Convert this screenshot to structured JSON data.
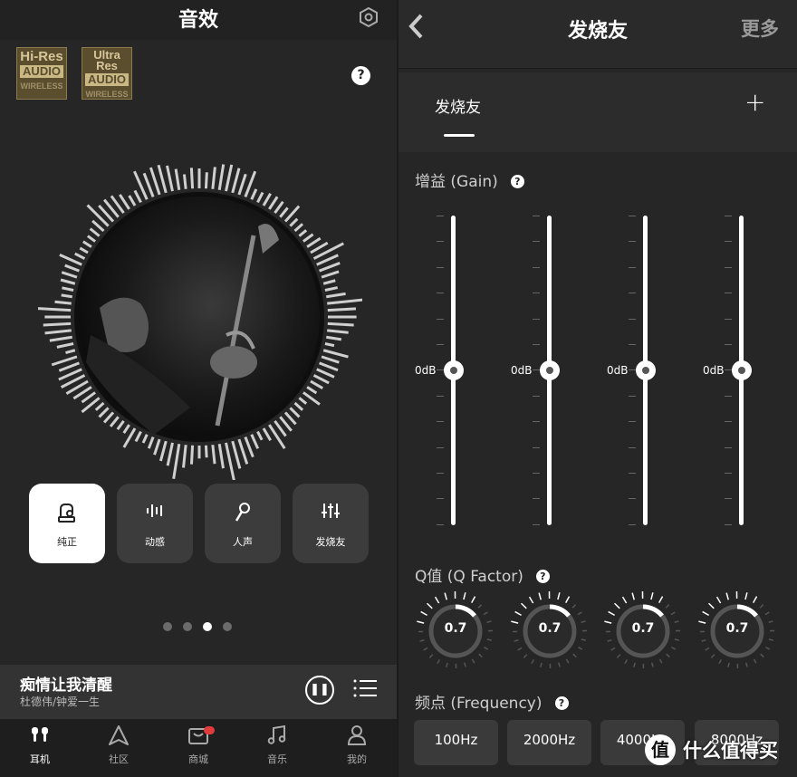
{
  "left": {
    "title": "音效",
    "badges": [
      {
        "l1": "Hi-Res",
        "l2": "AUDIO",
        "l3": "WIRELESS"
      },
      {
        "l1": "Ultra",
        "l1b": "Res",
        "l2": "AUDIO",
        "l3": "WIRELESS"
      }
    ],
    "help": "?",
    "modes": [
      {
        "label": "纯正",
        "icon": "gramophone-icon",
        "glyph": "♪"
      },
      {
        "label": "动感",
        "icon": "waveform-icon",
        "glyph": "ılı"
      },
      {
        "label": "人声",
        "icon": "microphone-icon",
        "glyph": "🎤"
      },
      {
        "label": "发烧友",
        "icon": "equalizer-icon",
        "glyph": "⫶"
      }
    ],
    "active_mode": 0,
    "page_dots": {
      "count": 4,
      "active": 2
    },
    "player": {
      "song": "痴情让我清醒",
      "artist": "杜德伟/钟爱一生"
    },
    "tabs": [
      {
        "label": "耳机",
        "icon": "earbuds-icon",
        "glyph": "◖◗"
      },
      {
        "label": "社区",
        "icon": "compass-icon",
        "glyph": "△"
      },
      {
        "label": "商城",
        "icon": "shop-icon",
        "glyph": "▭"
      },
      {
        "label": "音乐",
        "icon": "music-note-icon",
        "glyph": "♫"
      },
      {
        "label": "我的",
        "icon": "person-icon",
        "glyph": "◯"
      }
    ],
    "active_tab": 0
  },
  "right": {
    "title": "发烧友",
    "more": "更多",
    "preset_name": "发烧友",
    "plus": "+",
    "gain_label": "增益 (Gain)",
    "gain_values": [
      "0dB",
      "0dB",
      "0dB",
      "0dB"
    ],
    "q_label": "Q值 (Q Factor)",
    "q_values": [
      "0.7",
      "0.7",
      "0.7",
      "0.7"
    ],
    "freq_label": "频点 (Frequency)",
    "freq_values": [
      "100Hz",
      "2000Hz",
      "4000Hz",
      "8000Hz"
    ],
    "help": "?"
  },
  "watermark": {
    "logo": "值",
    "text": "什么值得买"
  }
}
